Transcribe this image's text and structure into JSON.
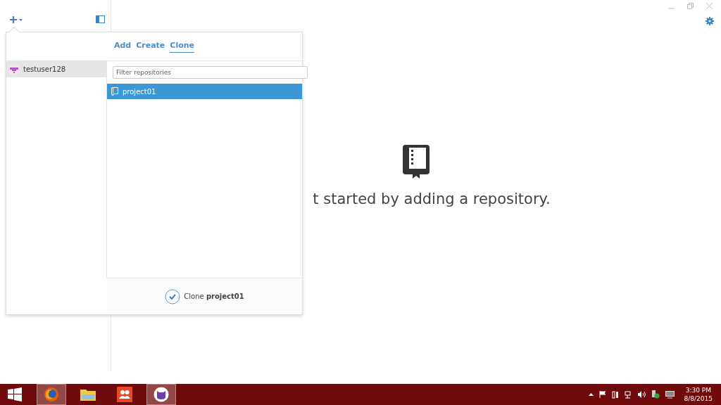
{
  "popover": {
    "tabs": [
      {
        "label": "Add",
        "selected": false
      },
      {
        "label": "Create",
        "selected": false
      },
      {
        "label": "Clone",
        "selected": true
      }
    ],
    "accounts": [
      {
        "name": "testuser128",
        "selected": true
      }
    ],
    "filter": {
      "placeholder": "Filter repositories"
    },
    "repositories": [
      {
        "name": "project01",
        "selected": true
      }
    ],
    "action": {
      "label": "Clone **project01**"
    }
  },
  "empty_state": {
    "message": "t started by adding a repository."
  },
  "taskbar": {
    "apps": [
      {
        "kind": "firefox",
        "selected": true
      },
      {
        "kind": "folder",
        "selected": false
      },
      {
        "kind": "people",
        "selected": false
      },
      {
        "kind": "github",
        "selected": true
      }
    ],
    "time": "3:30 PM",
    "date": "8/8/2015"
  }
}
